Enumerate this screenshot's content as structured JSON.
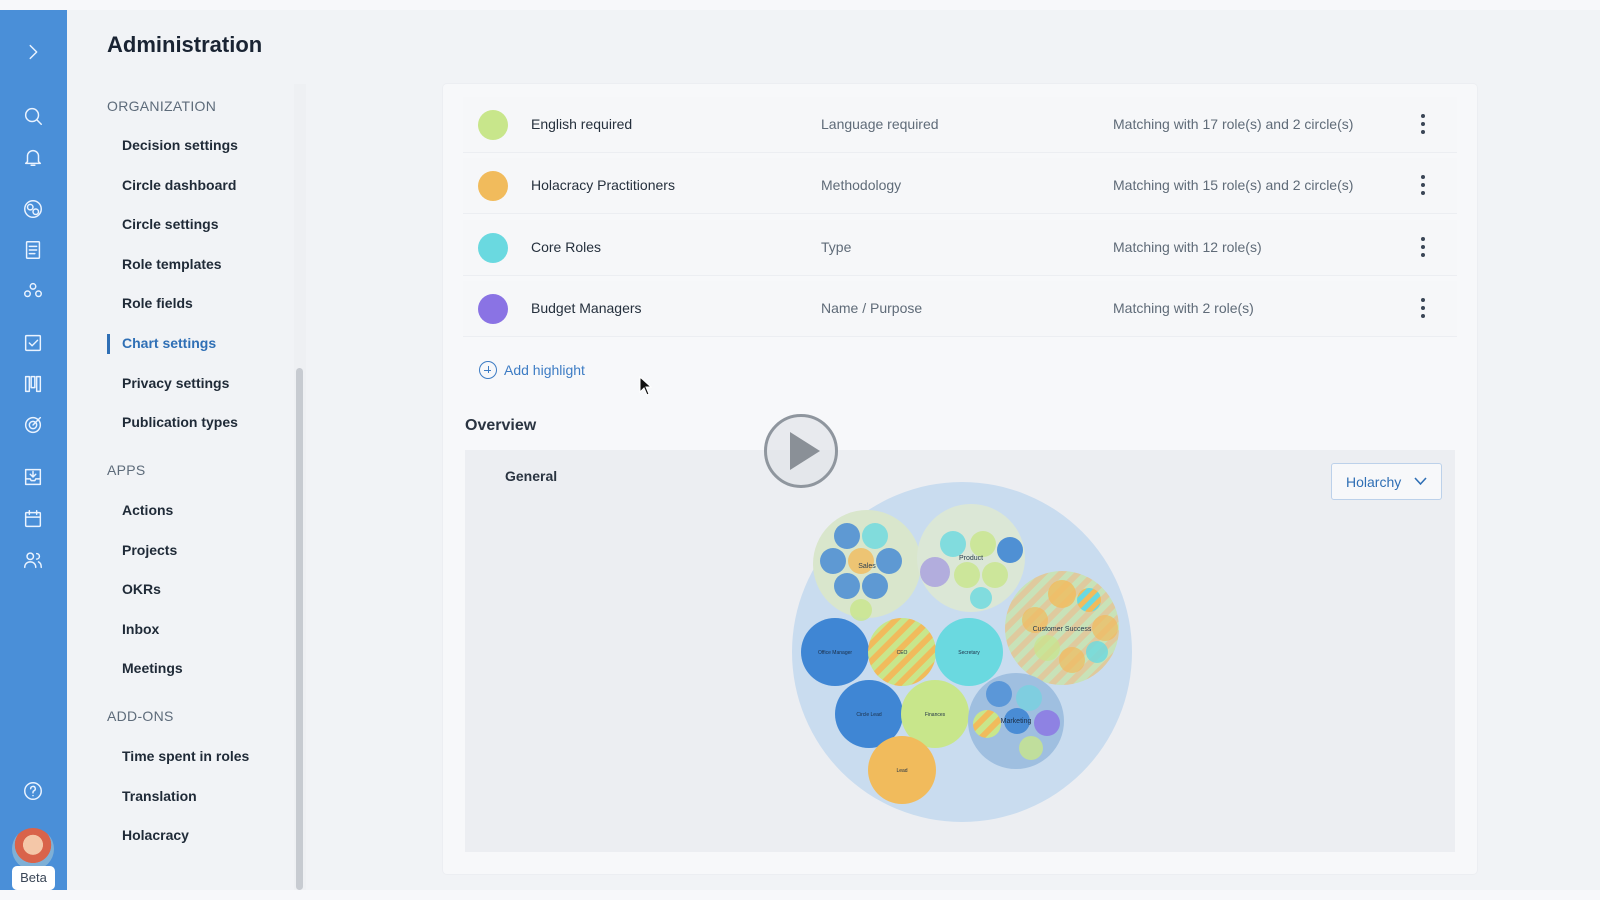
{
  "page": {
    "title": "Administration"
  },
  "rail": {
    "icons": [
      "chevron-right-icon",
      "search-icon",
      "bell-icon",
      "globe-icon",
      "document-icon",
      "people-circle-icon",
      "checkbox-icon",
      "kanban-icon",
      "target-icon",
      "inbox-icon",
      "calendar-icon",
      "users-icon",
      "help-icon"
    ],
    "beta_label": "Beta"
  },
  "nav": {
    "sections": [
      {
        "label": "ORGANIZATION",
        "items": [
          "Decision settings",
          "Circle dashboard",
          "Circle settings",
          "Role templates",
          "Role fields",
          "Chart settings",
          "Privacy settings",
          "Publication types"
        ]
      },
      {
        "label": "APPS",
        "items": [
          "Actions",
          "Projects",
          "OKRs",
          "Inbox",
          "Meetings"
        ]
      },
      {
        "label": "ADD-ONS",
        "items": [
          "Time spent in roles",
          "Translation",
          "Holacracy"
        ]
      }
    ],
    "active_item": "Chart settings"
  },
  "highlights": [
    {
      "name": "English required",
      "field": "Language required",
      "match": "Matching with 17 role(s) and 2 circle(s)",
      "color": "#c8e68b"
    },
    {
      "name": "Holacracy Practitioners",
      "field": "Methodology",
      "match": "Matching with 15 role(s) and 2 circle(s)",
      "color": "#f1bb5c"
    },
    {
      "name": "Core Roles",
      "field": "Type",
      "match": "Matching with 12 role(s)",
      "color": "#6ad9e0"
    },
    {
      "name": "Budget Managers",
      "field": "Name / Purpose",
      "match": "Matching with 2 role(s)",
      "color": "#8a73e4"
    }
  ],
  "add_highlight_label": "Add highlight",
  "overview": {
    "title": "Overview",
    "general_label": "General",
    "select_value": "Holarchy",
    "circle_labels": [
      "Sales",
      "Product",
      "Customer Success",
      "Office Manager",
      "Secretary",
      "Circle Lead",
      "Finances",
      "Marketing",
      "CEO",
      "Lead"
    ]
  },
  "colors": {
    "rail": "#4a8fd8",
    "accent": "#2f6fb5",
    "bubble_blue": "#3f86d4",
    "bubble_cyan": "#6ad9e0",
    "bubble_green": "#c8e68b",
    "bubble_orange": "#f1bb5c",
    "bubble_purple": "#8a73e4"
  }
}
